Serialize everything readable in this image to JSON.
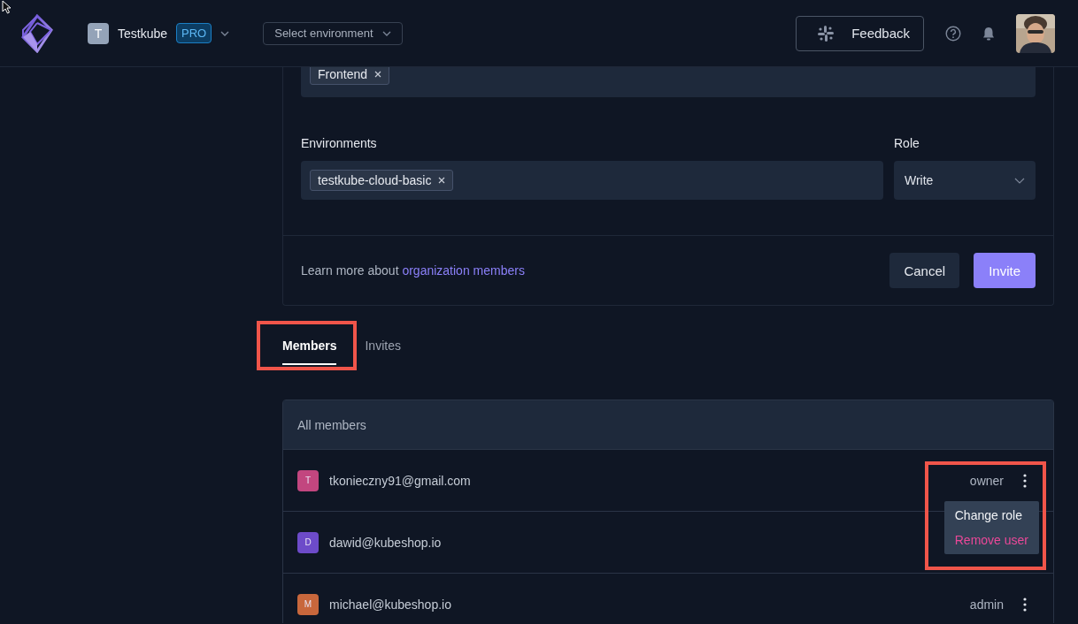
{
  "header": {
    "org_initial": "T",
    "org_name": "Testkube",
    "plan_badge": "PRO",
    "environment_select": "Select environment",
    "feedback_button": "Feedback"
  },
  "invite_form": {
    "teams_tags": [
      "Frontend"
    ],
    "environments_label": "Environments",
    "environment_tags": [
      "testkube-cloud-basic"
    ],
    "role_label": "Role",
    "role_value": "Write",
    "learn_more": "Learn more about",
    "learn_more_link": "organization members",
    "cancel_button": "Cancel",
    "invite_button": "Invite"
  },
  "tabs": [
    {
      "label": "Members",
      "selected": true,
      "highlighted": true
    },
    {
      "label": "Invites",
      "selected": false,
      "highlighted": false
    }
  ],
  "members": {
    "title": "All members",
    "rows": [
      {
        "initial": "T",
        "email": "tkonieczny91@gmail.com",
        "role": "owner",
        "color": "#c2467f",
        "menu_open": true
      },
      {
        "initial": "D",
        "email": "dawid@kubeshop.io",
        "role": "",
        "color": "#6d4bc9",
        "menu_open": false
      },
      {
        "initial": "M",
        "email": "michael@kubeshop.io",
        "role": "admin",
        "color": "#c8673c",
        "menu_open": false
      }
    ],
    "menu": [
      {
        "label": "Change role",
        "kind": "normal"
      },
      {
        "label": "Remove user",
        "kind": "danger"
      }
    ]
  }
}
